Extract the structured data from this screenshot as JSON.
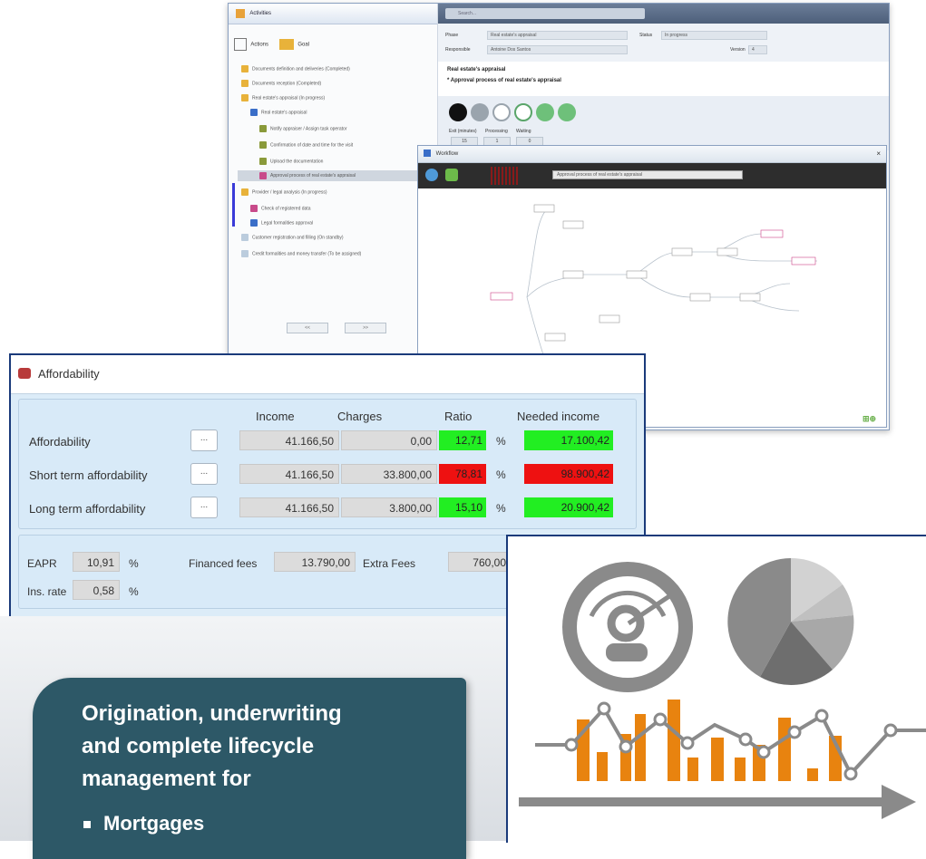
{
  "activities_window": {
    "title": "Activities",
    "search_placeholder": "Search...",
    "toolbar": {
      "actions": "Actions",
      "goal": "Goal"
    },
    "tree": [
      "Documents definition and deliveries (Completed)",
      "Documents reception (Completed)",
      "Real estate's appraisal (In progress)",
      "Real estate's appraisal",
      "Notify appraiser / Assign task operator",
      "Confirmation of date and time for the visit",
      "Upload the documentation",
      "Approval process of real estate's appraisal",
      "Provider / legal analysis (In progress)",
      "Check of registered data",
      "Legal formalities approval",
      "Customer registration and filling (On standby)",
      "Credit formalities and money transfer (To be assigned)"
    ],
    "bottom_buttons": [
      "<<",
      ">>"
    ],
    "header": {
      "phase_label": "Phase",
      "phase_value": "Real estate's appraisal",
      "status_label": "Status",
      "status_value": "In progress",
      "responsible_label": "Responsible",
      "responsible_value": "Antoine Dos Santos",
      "version_label": "Version",
      "version_value": "4"
    },
    "task_title": "Real estate's appraisal",
    "task_subtitle": "* Approval process of real estate's appraisal",
    "counters": {
      "labels": [
        "Exit (minutes)",
        "Processing",
        "Waiting"
      ],
      "values": [
        "15",
        "1",
        "0"
      ]
    }
  },
  "workflow_window": {
    "title": "Workflow",
    "search_value": "Approval process of real estate's appraisal"
  },
  "affordability": {
    "title": "Affordability",
    "columns": {
      "income": "Income",
      "charges": "Charges",
      "ratio": "Ratio",
      "needed": "Needed income"
    },
    "rows": [
      {
        "label": "Affordability",
        "button": "...",
        "income": "41.166,50",
        "charges": "0,00",
        "ratio": "12,71",
        "pct": "%",
        "needed": "17.100,42",
        "ratio_color": "#22ee22",
        "needed_color": "#22ee22"
      },
      {
        "label": "Short term affordability",
        "button": "...",
        "income": "41.166,50",
        "charges": "33.800,00",
        "ratio": "78,81",
        "pct": "%",
        "needed": "98.900,42",
        "ratio_color": "#ee1111",
        "needed_color": "#ee1111"
      },
      {
        "label": "Long term affordability",
        "button": "...",
        "income": "41.166,50",
        "charges": "3.800,00",
        "ratio": "15,10",
        "pct": "%",
        "needed": "20.900,42",
        "ratio_color": "#22ee22",
        "needed_color": "#22ee22"
      }
    ],
    "footer": {
      "eapr_label": "EAPR",
      "eapr_value": "10,91",
      "eapr_unit": "%",
      "financed_label": "Financed fees",
      "financed_value": "13.790,00",
      "extra_label": "Extra Fees",
      "extra_value": "760,00",
      "ins_label": "Ins. rate",
      "ins_value": "0,58",
      "ins_unit": "%"
    }
  },
  "banner": {
    "line1": "Origination, underwriting",
    "line2": "and  complete lifecycle",
    "line3": "management for",
    "bullet": "Mortgages"
  },
  "colors": {
    "accent_teal": "#2d5867",
    "chart_orange": "#e8830f",
    "icon_gray": "#8a8a8a"
  }
}
